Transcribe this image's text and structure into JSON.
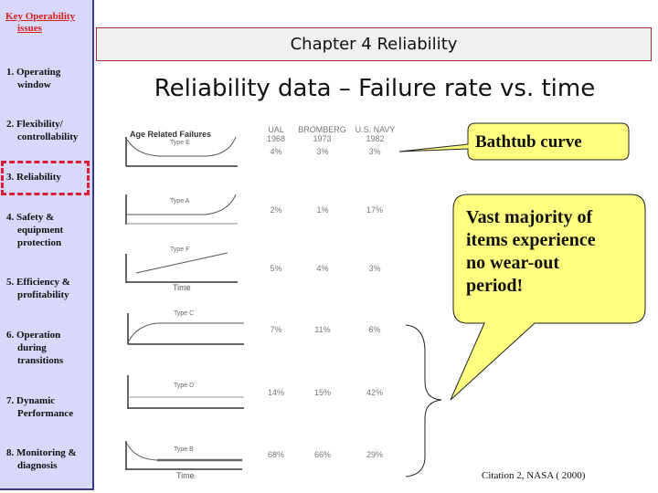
{
  "sidebar": {
    "title_line1": "Key Operability",
    "title_line2": "issues",
    "items": [
      {
        "num": "1. Operating",
        "cont": "window"
      },
      {
        "num": "2. Flexibility/",
        "cont": "controllability"
      },
      {
        "num": "3. Reliability",
        "cont": ""
      },
      {
        "num": "4. Safety &",
        "cont": "equipment",
        "cont2": "protection"
      },
      {
        "num": "5. Efficiency &",
        "cont": "profitability"
      },
      {
        "num": "6. Operation",
        "cont": "during",
        "cont2": "transitions"
      },
      {
        "num": "7. Dynamic",
        "cont": "Performance"
      },
      {
        "num": "8. Monitoring &",
        "cont": "diagnosis"
      }
    ],
    "selected_index": 2
  },
  "header": {
    "chapter": "Chapter 4 Reliability",
    "title": "Reliability data – Failure rate vs. time"
  },
  "figure": {
    "heading": "Age Related Failures",
    "time_label": "Time",
    "sources": [
      {
        "name": "UAL",
        "year": "1968"
      },
      {
        "name": "BROMBERG",
        "year": "1973"
      },
      {
        "name": "U.S. NAVY",
        "year": "1982"
      }
    ],
    "rows": [
      {
        "type": "Type E",
        "values": [
          "4%",
          "3%",
          "3%"
        ]
      },
      {
        "type": "Type A",
        "values": [
          "2%",
          "1%",
          "17%"
        ]
      },
      {
        "type": "Type F",
        "values": [
          "5%",
          "4%",
          "3%"
        ]
      },
      {
        "type": "Type C",
        "values": [
          "7%",
          "11%",
          "6%"
        ]
      },
      {
        "type": "Type D",
        "values": [
          "14%",
          "15%",
          "42%"
        ]
      },
      {
        "type": "Type B",
        "values": [
          "68%",
          "66%",
          "29%"
        ]
      }
    ]
  },
  "callouts": {
    "bathtub": "Bathtub curve",
    "vast": [
      "Vast majority of",
      "items experience",
      "no wear-out",
      "period!"
    ],
    "fill_color": "#ffff80"
  },
  "citation": "Citation 2, NASA ( 2000)"
}
